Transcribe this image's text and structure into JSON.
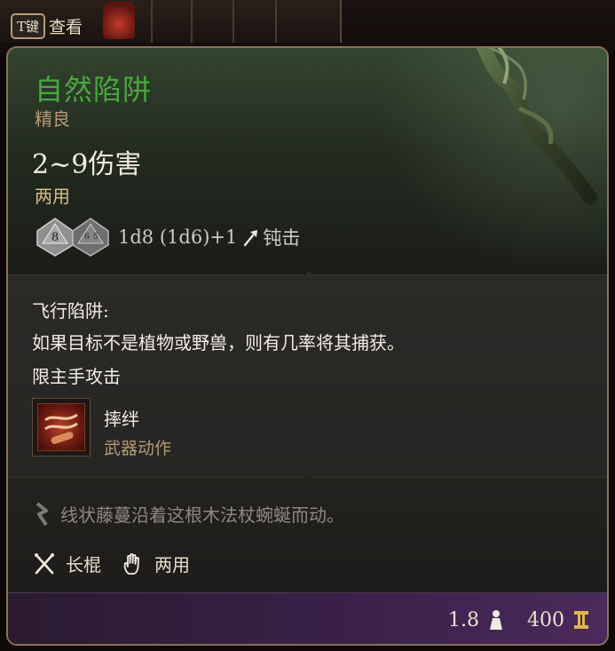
{
  "hud": {
    "key": "T键",
    "key_action": "查看"
  },
  "item": {
    "name": "自然陷阱",
    "rarity": "精良",
    "damage": "2~9伤害",
    "handedness": "两用",
    "dice_primary": "8",
    "dice_formula": "1d8 (1d6)+1",
    "damage_type": "钝击"
  },
  "ability": {
    "name": "飞行陷阱:",
    "description": "如果目标不是植物或野兽，则有几率将其捕获。",
    "restriction": "限主手攻击",
    "action_name": "摔绊",
    "action_type": "武器动作"
  },
  "flavor": {
    "text": "线状藤蔓沿着这根木法杖蜿蜒而动。"
  },
  "properties": [
    {
      "icon": "crossed-staves-icon",
      "label": "长棍"
    },
    {
      "icon": "hand-icon",
      "label": "两用"
    }
  ],
  "footer": {
    "weight": "1.8",
    "value": "400"
  },
  "colors": {
    "name_uncommon_green": "#49a83e",
    "rarity_tan": "#b69a74",
    "border_gold": "#8c7355",
    "footer_purple": "#3a2048"
  }
}
